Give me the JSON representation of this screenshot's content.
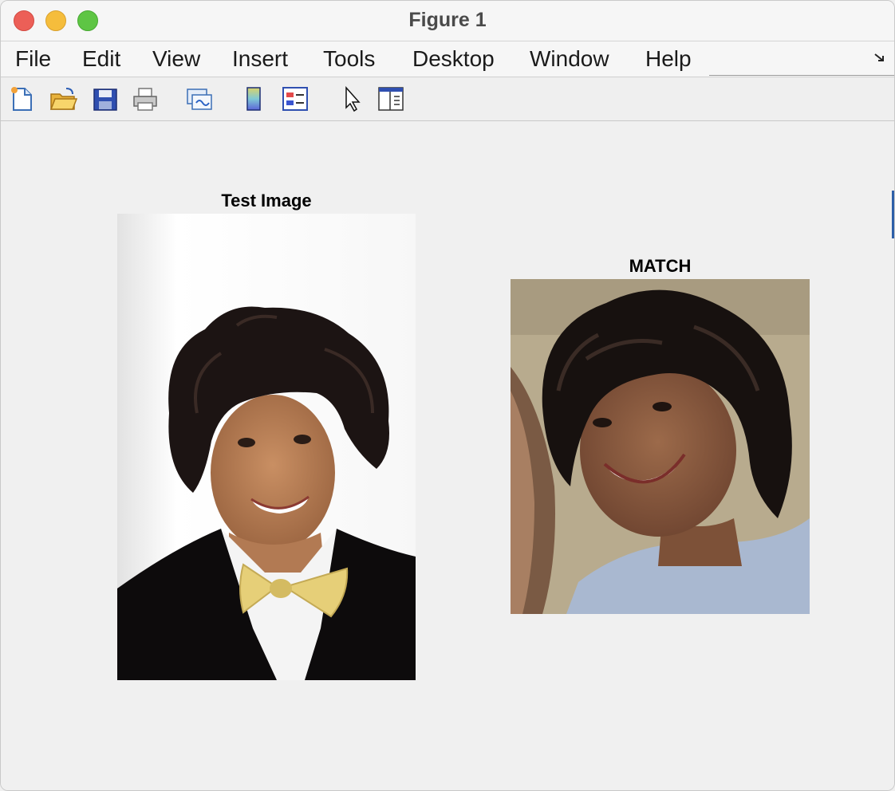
{
  "window": {
    "title": "Figure 1"
  },
  "menu": {
    "items": [
      "File",
      "Edit",
      "View",
      "Insert",
      "Tools",
      "Desktop",
      "Window",
      "Help"
    ]
  },
  "toolbar": {
    "buttons": [
      "new-figure-icon",
      "open-file-icon",
      "save-icon",
      "print-icon",
      "link-plot-icon",
      "colorbar-icon",
      "legend-icon",
      "edit-plot-icon",
      "property-inspector-icon"
    ]
  },
  "axes": [
    {
      "title": "Test Image",
      "image": "formal-portrait-photo"
    },
    {
      "title": "MATCH",
      "image": "casual-smiling-photo"
    }
  ]
}
